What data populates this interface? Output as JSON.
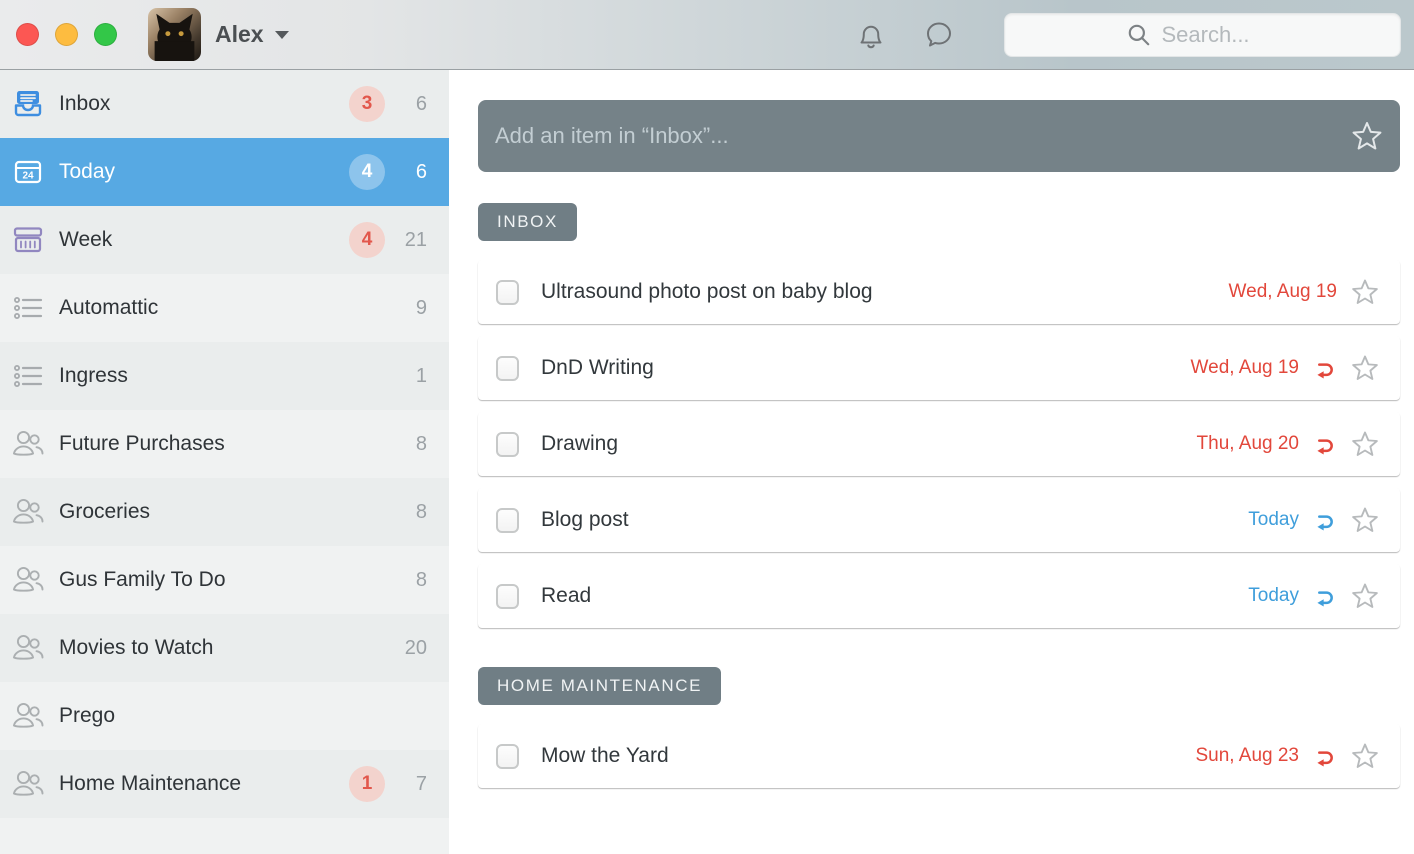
{
  "toolbar": {
    "user_name": "Alex",
    "search_placeholder": "Search...",
    "icons": [
      "bell-icon",
      "chat-bubble-icon",
      "search-icon"
    ]
  },
  "window_controls": [
    "close",
    "minimize",
    "zoom"
  ],
  "sidebar": {
    "items": [
      {
        "icon": "inbox-icon",
        "label": "Inbox",
        "badge": "3",
        "count": "6",
        "selected": false
      },
      {
        "icon": "today-icon",
        "label": "Today",
        "badge": "4",
        "count": "6",
        "selected": true
      },
      {
        "icon": "week-icon",
        "label": "Week",
        "badge": "4",
        "count": "21",
        "selected": false
      },
      {
        "icon": "list-icon",
        "label": "Automattic",
        "badge": null,
        "count": "9",
        "selected": false
      },
      {
        "icon": "list-icon",
        "label": "Ingress",
        "badge": null,
        "count": "1",
        "selected": false
      },
      {
        "icon": "people-icon",
        "label": "Future Purchases",
        "badge": null,
        "count": "8",
        "selected": false
      },
      {
        "icon": "people-icon",
        "label": "Groceries",
        "badge": null,
        "count": "8",
        "selected": false
      },
      {
        "icon": "people-icon",
        "label": "Gus Family To Do",
        "badge": null,
        "count": "8",
        "selected": false
      },
      {
        "icon": "people-icon",
        "label": "Movies to Watch",
        "badge": null,
        "count": "20",
        "selected": false
      },
      {
        "icon": "people-icon",
        "label": "Prego",
        "badge": null,
        "count": null,
        "selected": false
      },
      {
        "icon": "people-icon",
        "label": "Home Maintenance",
        "badge": "1",
        "count": "7",
        "selected": false
      }
    ]
  },
  "main": {
    "add_placeholder": "Add an item in “Inbox”...",
    "sections": [
      {
        "label": "INBOX",
        "tasks": [
          {
            "title": "Ultrasound photo post on baby blog",
            "due": "Wed, Aug 19",
            "tone": "overdue",
            "repeat": false,
            "starred": false
          },
          {
            "title": "DnD Writing",
            "due": "Wed, Aug 19",
            "tone": "overdue",
            "repeat": true,
            "starred": false
          },
          {
            "title": "Drawing",
            "due": "Thu, Aug 20",
            "tone": "overdue",
            "repeat": true,
            "starred": false
          },
          {
            "title": "Blog post",
            "due": "Today",
            "tone": "today",
            "repeat": true,
            "starred": false
          },
          {
            "title": "Read",
            "due": "Today",
            "tone": "today",
            "repeat": true,
            "starred": false
          }
        ]
      },
      {
        "label": "HOME MAINTENANCE",
        "tasks": [
          {
            "title": "Mow the Yard",
            "due": "Sun, Aug 23",
            "tone": "overdue",
            "repeat": true,
            "starred": false
          }
        ]
      }
    ]
  },
  "colors": {
    "sidebar_selected_blue": "#57a9e3",
    "overdue_red": "#e2473b",
    "today_blue": "#3f9edb",
    "badge_red_bg": "#f3d3cd",
    "badge_red_text": "#e2574c",
    "inbox_icon_blue": "#3e8ee0",
    "week_icon_purple": "#9187c0",
    "main_bg_top": "#153f4c",
    "main_bg_bottom": "#7e9aa2",
    "traffic_red": "#fc5753",
    "traffic_yellow": "#fdbc40",
    "traffic_green": "#33c748"
  }
}
